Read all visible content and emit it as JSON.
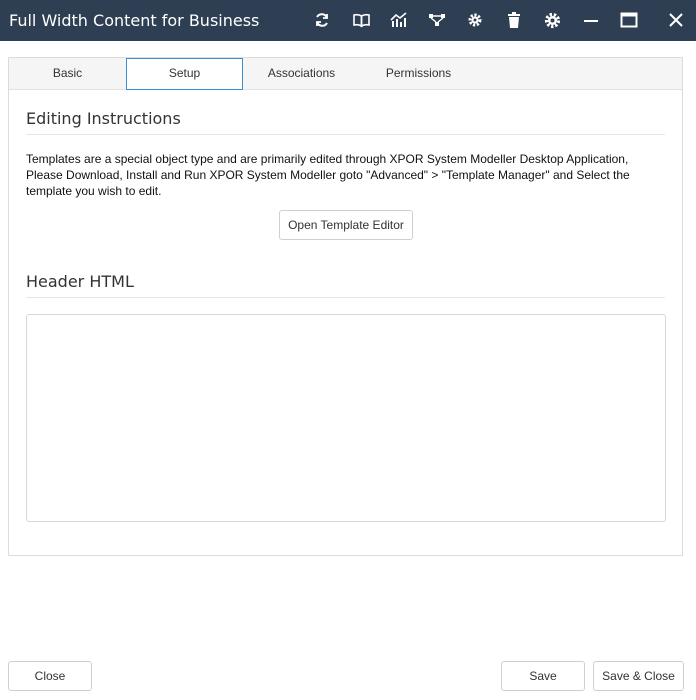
{
  "window": {
    "title": "Full Width Content for Business",
    "toolbar_icons": [
      "refresh-icon",
      "book-icon",
      "chart-icon",
      "workflow-icon",
      "settings-cog-icon",
      "trash-icon",
      "gear-icon",
      "minimize-icon",
      "maximize-icon",
      "close-icon"
    ]
  },
  "tabs": [
    {
      "label": "Basic",
      "active": false
    },
    {
      "label": "Setup",
      "active": true
    },
    {
      "label": "Associations",
      "active": false
    },
    {
      "label": "Permissions",
      "active": false
    }
  ],
  "setup": {
    "editing_title": "Editing Instructions",
    "instructions": "Templates are a special object type and are primarily edited through XPOR System Modeller Desktop Application, Please Download, Install and Run XPOR System Modeller goto \"Advanced\" > \"Template Manager\" and Select the template you wish to edit.",
    "open_editor_label": "Open Template Editor",
    "header_title": "Header HTML",
    "header_html_value": ""
  },
  "footer": {
    "close_label": "Close",
    "save_label": "Save",
    "save_close_label": "Save & Close"
  },
  "colors": {
    "titlebar": "#2e3f53",
    "active_tab_border": "#3d8fd1"
  }
}
